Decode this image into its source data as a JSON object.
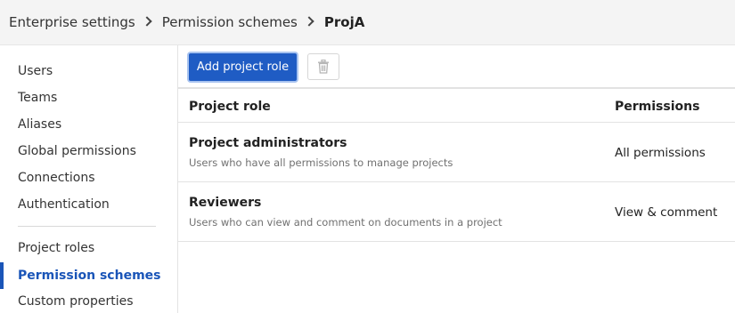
{
  "breadcrumb": {
    "items": [
      "Enterprise settings",
      "Permission schemes"
    ],
    "current": "ProjA"
  },
  "sidebar": {
    "items": [
      {
        "label": "Users"
      },
      {
        "label": "Teams"
      },
      {
        "label": "Aliases"
      },
      {
        "label": "Global permissions"
      },
      {
        "label": "Connections"
      },
      {
        "label": "Authentication"
      },
      {
        "label": "Project roles"
      },
      {
        "label": "Permission schemes",
        "active": true
      },
      {
        "label": "Custom properties"
      }
    ]
  },
  "toolbar": {
    "add_label": "Add project role",
    "delete_icon": "trash-icon"
  },
  "table": {
    "headers": {
      "role": "Project role",
      "permissions": "Permissions"
    },
    "rows": [
      {
        "title": "Project administrators",
        "description": "Users who have all permissions to manage projects",
        "permissions": "All permissions"
      },
      {
        "title": "Reviewers",
        "description": "Users who can view and comment on documents in a project",
        "permissions": "View & comment"
      }
    ]
  },
  "colors": {
    "accent": "#1f5cc4",
    "active_nav": "#1a55b8",
    "header_bg": "#f4f4f4"
  }
}
